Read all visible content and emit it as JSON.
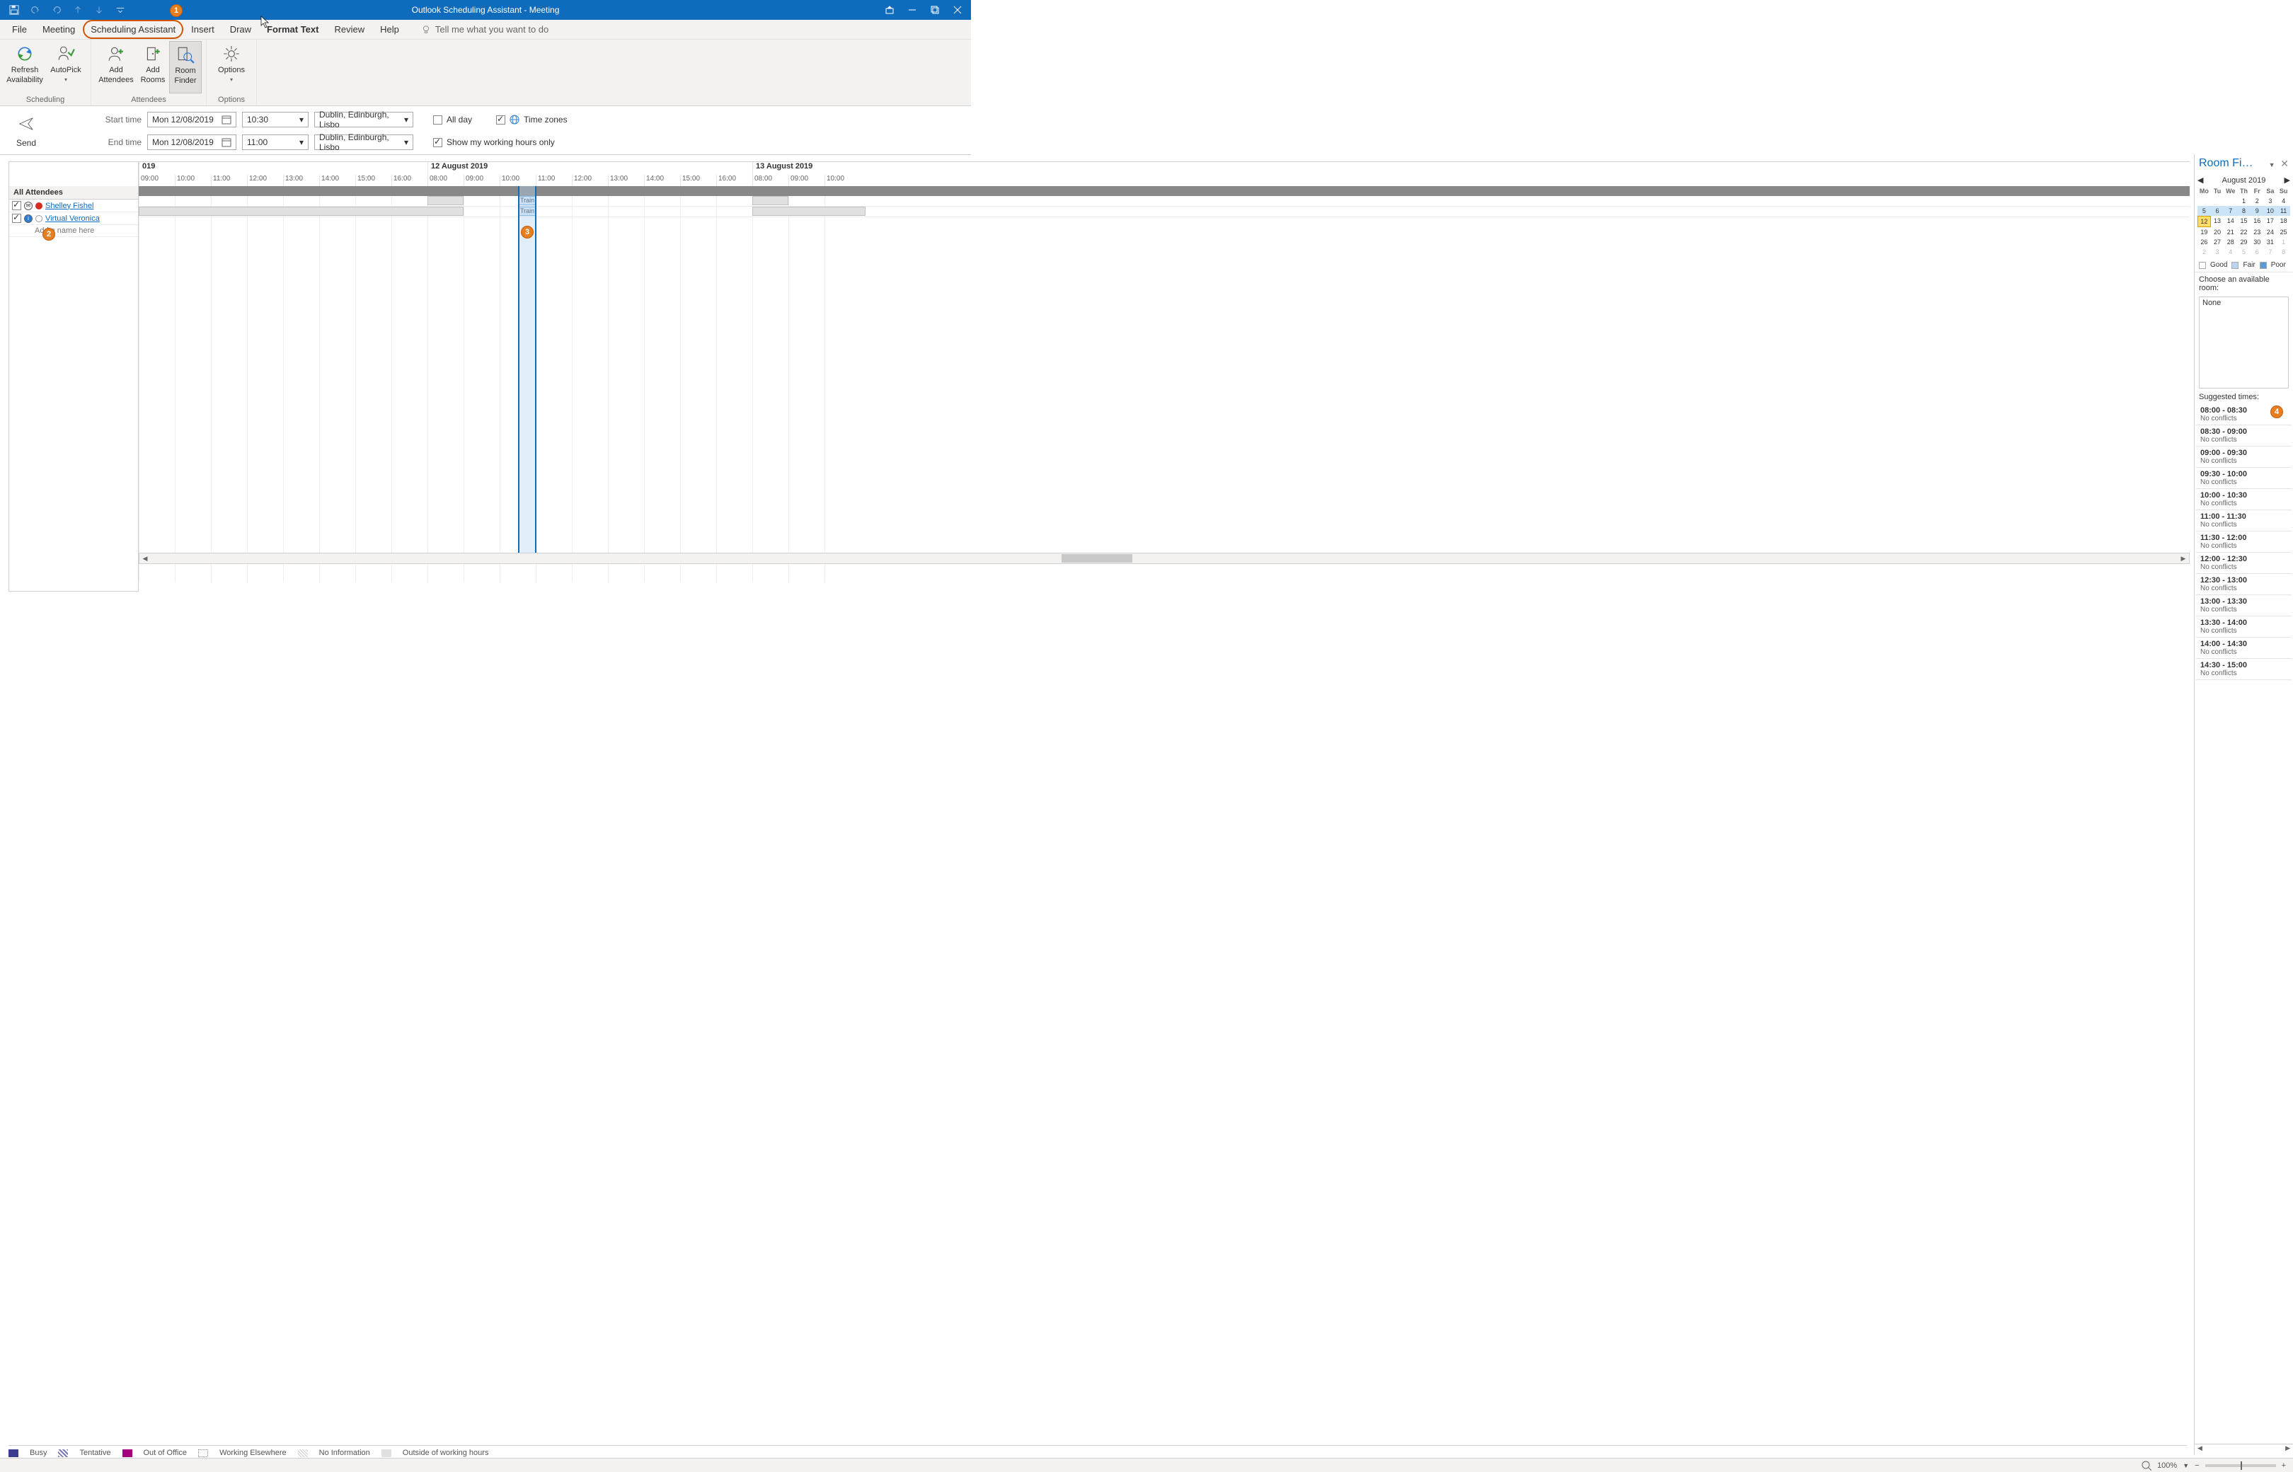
{
  "window": {
    "title": "Outlook Scheduling Assistant  -  Meeting"
  },
  "tabs": {
    "file": "File",
    "meeting": "Meeting",
    "scheduling": "Scheduling Assistant",
    "insert": "Insert",
    "draw": "Draw",
    "format_text": "Format Text",
    "review": "Review",
    "help": "Help",
    "tellme_placeholder": "Tell me what you want to do"
  },
  "ribbon": {
    "refresh": "Refresh Availability",
    "autopick": "AutoPick",
    "add_attendees": "Add Attendees",
    "add_rooms": "Add Rooms",
    "room_finder": "Room Finder",
    "options": "Options",
    "group_scheduling": "Scheduling",
    "group_attendees": "Attendees",
    "group_options": "Options"
  },
  "send": {
    "label": "Send"
  },
  "form": {
    "start_label": "Start time",
    "end_label": "End time",
    "date": "Mon 12/08/2019",
    "start_time": "10:30",
    "end_time": "11:00",
    "tz": "Dublin, Edinburgh, Lisbo",
    "all_day": "All day",
    "time_zones": "Time zones",
    "working_hours": "Show my working hours only"
  },
  "attendees": {
    "header": "All Attendees",
    "rows": [
      {
        "name": "Shelley Fishel"
      },
      {
        "name": "Virtual Veronica"
      }
    ],
    "add_placeholder": "Add a name here"
  },
  "timeline": {
    "day1_partial": "019",
    "day2": "12 August 2019",
    "day3": "13 August 2019",
    "hours_left": [
      "09:00",
      "10:00",
      "11:00",
      "12:00",
      "13:00",
      "14:00",
      "15:00",
      "16:00"
    ],
    "hours_mid": [
      "08:00",
      "09:00",
      "10:00",
      "11:00",
      "12:00",
      "13:00",
      "14:00",
      "15:00",
      "16:00"
    ],
    "hours_right": [
      "08:00",
      "09:00",
      "10:00"
    ],
    "event_label": "Train"
  },
  "room_finder": {
    "title": "Room Fi…",
    "month": "August 2019",
    "dow": [
      "Mo",
      "Tu",
      "We",
      "Th",
      "Fr",
      "Sa",
      "Su"
    ],
    "weeks": [
      [
        "",
        "",
        "",
        "1",
        "2",
        "3",
        "4"
      ],
      [
        "5",
        "6",
        "7",
        "8",
        "9",
        "10",
        "11"
      ],
      [
        "12",
        "13",
        "14",
        "15",
        "16",
        "17",
        "18"
      ],
      [
        "19",
        "20",
        "21",
        "22",
        "23",
        "24",
        "25"
      ],
      [
        "26",
        "27",
        "28",
        "29",
        "30",
        "31",
        "1"
      ],
      [
        "2",
        "3",
        "4",
        "5",
        "6",
        "7",
        "8"
      ]
    ],
    "legend_good": "Good",
    "legend_fair": "Fair",
    "legend_poor": "Poor",
    "choose": "Choose an available room:",
    "none": "None",
    "suggested_label": "Suggested times:",
    "slots": [
      {
        "t": "08:00 - 08:30",
        "c": "No conflicts"
      },
      {
        "t": "08:30 - 09:00",
        "c": "No conflicts"
      },
      {
        "t": "09:00 - 09:30",
        "c": "No conflicts"
      },
      {
        "t": "09:30 - 10:00",
        "c": "No conflicts"
      },
      {
        "t": "10:00 - 10:30",
        "c": "No conflicts"
      },
      {
        "t": "11:00 - 11:30",
        "c": "No conflicts"
      },
      {
        "t": "11:30 - 12:00",
        "c": "No conflicts"
      },
      {
        "t": "12:00 - 12:30",
        "c": "No conflicts"
      },
      {
        "t": "12:30 - 13:00",
        "c": "No conflicts"
      },
      {
        "t": "13:00 - 13:30",
        "c": "No conflicts"
      },
      {
        "t": "13:30 - 14:00",
        "c": "No conflicts"
      },
      {
        "t": "14:00 - 14:30",
        "c": "No conflicts"
      },
      {
        "t": "14:30 - 15:00",
        "c": "No conflicts"
      }
    ]
  },
  "legend": {
    "busy": "Busy",
    "tentative": "Tentative",
    "ooo": "Out of Office",
    "elsewhere": "Working Elsewhere",
    "noinfo": "No Information",
    "outside": "Outside of working hours"
  },
  "status": {
    "zoom": "100%"
  },
  "markers": {
    "m1": "1",
    "m2": "2",
    "m3": "3",
    "m4": "4"
  }
}
